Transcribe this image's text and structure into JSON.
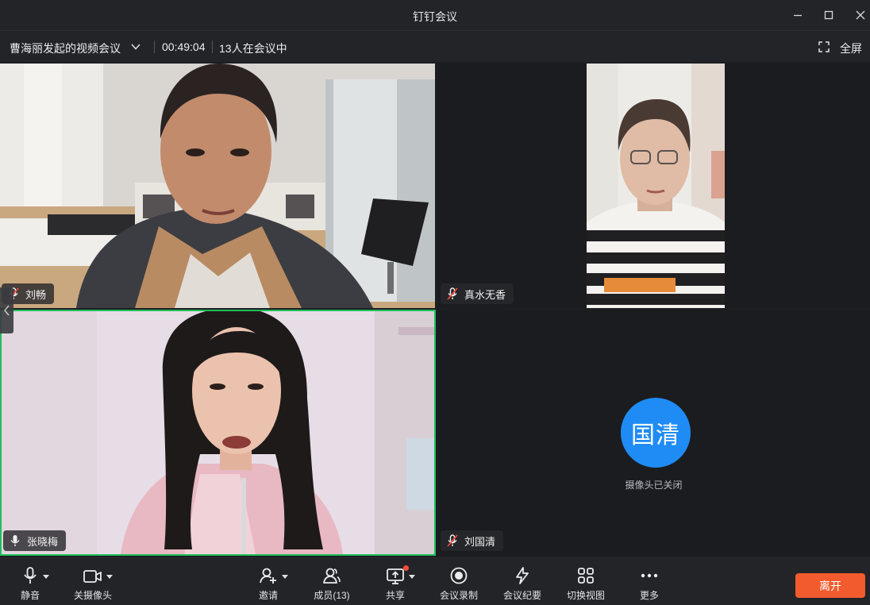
{
  "window": {
    "title": "钉钉会议"
  },
  "info_bar": {
    "meeting_name": "曹海丽发起的视频会议",
    "duration": "00:49:04",
    "participants_status": "13人在会议中",
    "fullscreen_label": "全屏"
  },
  "tiles": [
    {
      "name": "刘畅",
      "mic": "muted",
      "video": "on"
    },
    {
      "name": "真水无香",
      "mic": "muted",
      "video": "on"
    },
    {
      "name": "张晓梅",
      "mic": "on",
      "video": "on",
      "speaking": true
    },
    {
      "name": "刘国清",
      "mic": "muted",
      "video": "off",
      "avatar_text": "国清",
      "camera_off_text": "摄像头已关闭"
    }
  ],
  "toolbar": {
    "mute": "静音",
    "camera_off": "关摄像头",
    "invite": "邀请",
    "members": "成员(13)",
    "share": "共享",
    "record": "会议录制",
    "minutes": "会议纪要",
    "switch_view": "切换视图",
    "more": "更多",
    "leave": "离开"
  },
  "colors": {
    "accent_blue": "#1f8cf5",
    "leave_orange": "#f25b2e",
    "speaking_green": "#1fbf5b",
    "notification_red": "#ff4a3d"
  },
  "icons": [
    "chevron-down-icon",
    "fullscreen-icon",
    "mic-muted-icon",
    "mic-icon",
    "camera-icon",
    "add-person-icon",
    "people-icon",
    "screen-share-icon",
    "record-icon",
    "lightning-icon",
    "grid-view-icon",
    "more-icon"
  ]
}
